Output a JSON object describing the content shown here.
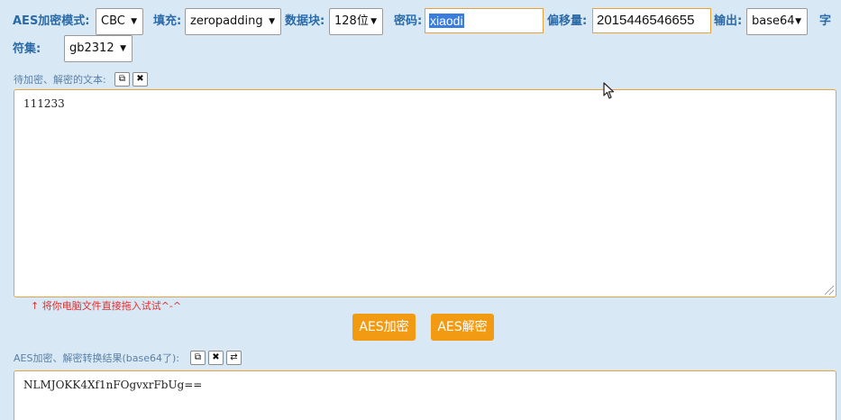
{
  "mode": {
    "label": "AES加密模式:",
    "value": "CBC"
  },
  "padding": {
    "label": "填充:",
    "value": "zeropadding"
  },
  "block": {
    "label": "数据块:",
    "value": "128位"
  },
  "password": {
    "label": "密码:",
    "value": "xiaodi"
  },
  "offset": {
    "label": "偏移量:",
    "value": "2015446546655"
  },
  "output": {
    "label": "输出:",
    "value": "base64"
  },
  "charset": {
    "label_part1": "字",
    "label_part2": "符集:",
    "value": "gb2312"
  },
  "input_area": {
    "label": "待加密、解密的文本:",
    "copy_icon": "⧉",
    "clear_icon": "✖",
    "text": "111233"
  },
  "hint": "↑ 将你电脑文件直接拖入试试^-^",
  "buttons": {
    "encrypt": "AES加密",
    "decrypt": "AES解密"
  },
  "result_area": {
    "label": "AES加密、解密转换结果(base64了):",
    "copy_icon": "⧉",
    "clear_icon": "✖",
    "swap_icon": "⇄",
    "text": "NLMJOKK4Xf1nFOgvxrFbUg=="
  },
  "icons": {
    "dropdown": "chevron-down-icon",
    "cursor": "mouse-pointer-icon"
  },
  "colors": {
    "background": "#d8e9f5",
    "accent": "#f39a13",
    "label": "#2a6aa8",
    "hint": "#e03030"
  }
}
